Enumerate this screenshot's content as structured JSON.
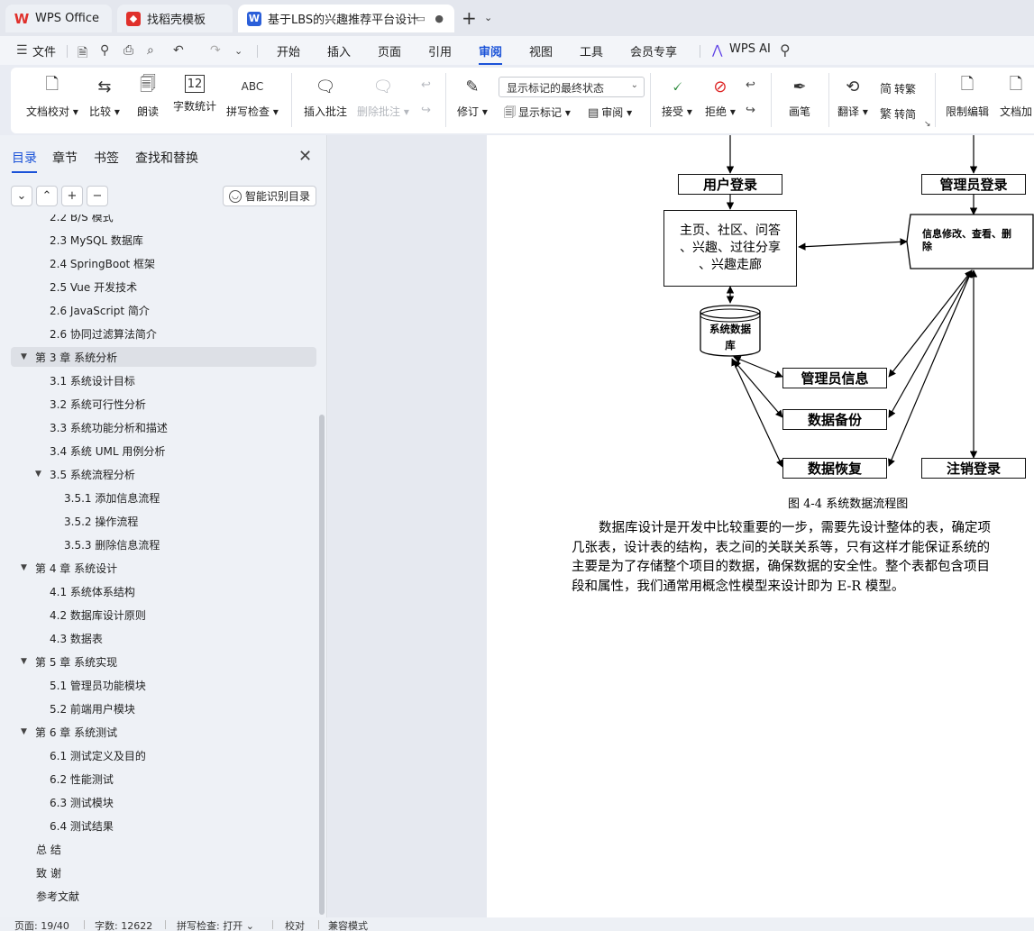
{
  "tabs": [
    {
      "label": "WPS Office",
      "icon": "wps-logo-icon"
    },
    {
      "label": "找稻壳模板",
      "icon": "docer-icon"
    },
    {
      "label": "基于LBS的兴趣推荐平台设计与",
      "icon": "writer-doc-icon",
      "active": true
    }
  ],
  "menu": {
    "file": "文件",
    "items": [
      "开始",
      "插入",
      "页面",
      "引用",
      "审阅",
      "视图",
      "工具",
      "会员专享"
    ],
    "active": "审阅",
    "wps_ai": "WPS AI"
  },
  "ribbon": {
    "doc_check": "文档校对",
    "compare": "比较",
    "read_aloud": "朗读",
    "word_count": "字数统计",
    "spell_check": "拼写检查",
    "insert_comment": "插入批注",
    "delete_comment": "删除批注",
    "track_changes": "修订",
    "markup_state": "显示标记的最终状态",
    "show_markup": "显示标记",
    "review": "审阅",
    "accept": "接受",
    "reject": "拒绝",
    "ink": "画笔",
    "translate": "翻译",
    "to_traditional": "转繁",
    "to_simplified": "转简",
    "restrict_edit": "限制编辑",
    "doc_encrypt": "文档加"
  },
  "nav": {
    "tabs": [
      "目录",
      "章节",
      "书签",
      "查找和替换"
    ],
    "smart_toc": "智能识别目录",
    "toc": [
      {
        "text": "2.2 B/S 模式",
        "level": 2
      },
      {
        "text": "2.3 MySQL 数据库",
        "level": 2
      },
      {
        "text": "2.4 SpringBoot 框架",
        "level": 2
      },
      {
        "text": "2.5 Vue 开发技术",
        "level": 2
      },
      {
        "text": "2.6 JavaScript 简介",
        "level": 2
      },
      {
        "text": "2.6  协同过滤算法简介",
        "level": 2
      },
      {
        "text": "第 3 章  系统分析",
        "level": 1,
        "selected": true
      },
      {
        "text": "3.1  系统设计目标",
        "level": 2
      },
      {
        "text": "3.2  系统可行性分析",
        "level": 2
      },
      {
        "text": "3.3  系统功能分析和描述",
        "level": 2
      },
      {
        "text": "3.4  系统 UML 用例分析",
        "level": 2
      },
      {
        "text": "3.5 系统流程分析",
        "level": 2,
        "expandable": true
      },
      {
        "text": "3.5.1 添加信息流程",
        "level": 3
      },
      {
        "text": "3.5.2 操作流程",
        "level": 3
      },
      {
        "text": "3.5.3 删除信息流程",
        "level": 3
      },
      {
        "text": "第 4 章  系统设计",
        "level": 1
      },
      {
        "text": "4.1  系统体系结构",
        "level": 2
      },
      {
        "text": "4.2  数据库设计原则",
        "level": 2
      },
      {
        "text": "4.3  数据表",
        "level": 2
      },
      {
        "text": "第 5 章  系统实现",
        "level": 1
      },
      {
        "text": "5.1  管理员功能模块",
        "level": 2
      },
      {
        "text": "5.2  前端用户模块",
        "level": 2
      },
      {
        "text": "第 6 章  系统测试",
        "level": 1
      },
      {
        "text": "6.1 测试定义及目的",
        "level": 2
      },
      {
        "text": "6.2 性能测试",
        "level": 2
      },
      {
        "text": "6.3 测试模块",
        "level": 2
      },
      {
        "text": "6.4 测试结果",
        "level": 2
      },
      {
        "text": "总    结",
        "level": 0
      },
      {
        "text": "致    谢",
        "level": 0
      },
      {
        "text": "参考文献",
        "level": 0
      }
    ]
  },
  "flowchart": {
    "user_login": "用户登录",
    "admin_login": "管理员登录",
    "user_features_lines": [
      "主页、社区、问答",
      "、兴趣、过往分享",
      "、兴趣走廊"
    ],
    "admin_ops_lines": [
      "信息修改、查看、删",
      "除"
    ],
    "database_lines": [
      "系统数据",
      "库"
    ],
    "admin_info": "管理员信息",
    "data_backup": "数据备份",
    "data_restore": "数据恢复",
    "logout": "注销登录"
  },
  "document": {
    "caption": "图 4-4  系统数据流程图",
    "paragraph_lines": [
      "数据库设计是开发中比较重要的一步，需要先设计整体的表，确定项",
      "几张表，设计表的结构，表之间的关联关系等，只有这样才能保证系统的",
      "主要是为了存储整个项目的数据，确保数据的安全性。整个表都包含项目",
      "段和属性，我们通常用概念性模型来设计即为 E-R 模型。"
    ]
  },
  "status": {
    "page": "页面: 19/40",
    "words": "字数: 12622",
    "spell": "拼写检查: 打开",
    "proof": "校对",
    "compat": "兼容模式"
  },
  "colors": {
    "accent": "#1a52d8",
    "wps_red": "#e0302b"
  }
}
